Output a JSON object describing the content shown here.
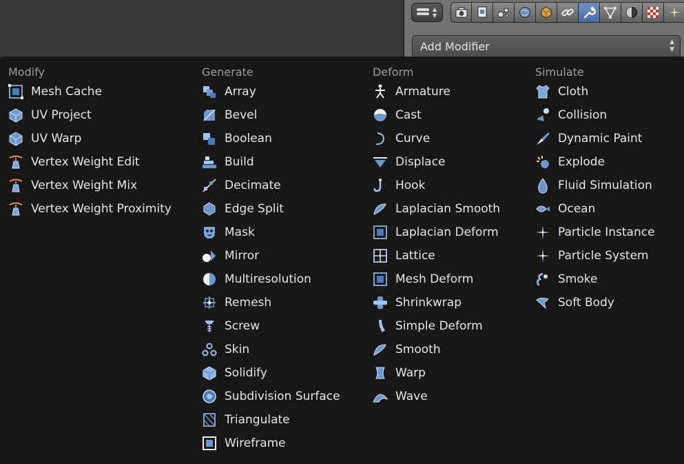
{
  "header": {
    "add_modifier_label": "Add Modifier",
    "properties_tabs": [
      {
        "icon": "camera-render-icon",
        "active": false
      },
      {
        "icon": "render-layers-icon",
        "active": false
      },
      {
        "icon": "scene-icon",
        "active": false
      },
      {
        "icon": "world-icon",
        "active": false
      },
      {
        "icon": "object-cube-icon",
        "active": false
      },
      {
        "icon": "constraints-chain-icon",
        "active": false
      },
      {
        "icon": "modifiers-wrench-icon",
        "active": true
      },
      {
        "icon": "object-data-vertex-icon",
        "active": false
      },
      {
        "icon": "material-sphere-icon",
        "active": false
      },
      {
        "icon": "texture-checker-icon",
        "active": false
      },
      {
        "icon": "particles-icon",
        "active": false
      }
    ]
  },
  "menu": {
    "columns": [
      {
        "title": "Modify",
        "items": [
          "Mesh Cache",
          "UV Project",
          "UV Warp",
          "Vertex Weight Edit",
          "Vertex Weight Mix",
          "Vertex Weight Proximity"
        ]
      },
      {
        "title": "Generate",
        "items": [
          "Array",
          "Bevel",
          "Boolean",
          "Build",
          "Decimate",
          "Edge Split",
          "Mask",
          "Mirror",
          "Multiresolution",
          "Remesh",
          "Screw",
          "Skin",
          "Solidify",
          "Subdivision Surface",
          "Triangulate",
          "Wireframe"
        ]
      },
      {
        "title": "Deform",
        "items": [
          "Armature",
          "Cast",
          "Curve",
          "Displace",
          "Hook",
          "Laplacian Smooth",
          "Laplacian Deform",
          "Lattice",
          "Mesh Deform",
          "Shrinkwrap",
          "Simple Deform",
          "Smooth",
          "Warp",
          "Wave"
        ]
      },
      {
        "title": "Simulate",
        "items": [
          "Cloth",
          "Collision",
          "Dynamic Paint",
          "Explode",
          "Fluid Simulation",
          "Ocean",
          "Particle Instance",
          "Particle System",
          "Smoke",
          "Soft Body"
        ]
      }
    ]
  }
}
